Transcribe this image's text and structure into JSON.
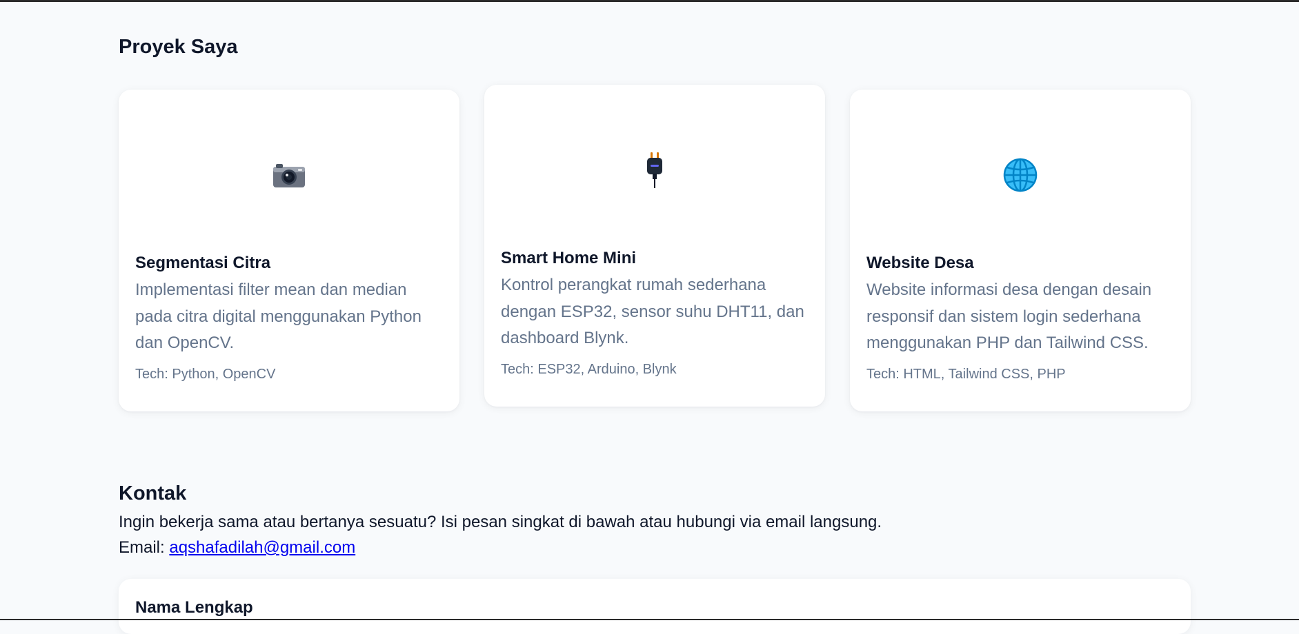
{
  "projects": {
    "title": "Proyek Saya",
    "items": [
      {
        "icon": "camera-icon",
        "title": "Segmentasi Citra",
        "description": "Implementasi filter mean dan median pada citra digital menggunakan Python dan OpenCV.",
        "tech": "Tech: Python, OpenCV"
      },
      {
        "icon": "electric-plug-icon",
        "title": "Smart Home Mini",
        "description": "Kontrol perangkat rumah sederhana dengan ESP32, sensor suhu DHT11, dan dashboard Blynk.",
        "tech": "Tech: ESP32, Arduino, Blynk"
      },
      {
        "icon": "globe-icon",
        "title": "Website Desa",
        "description": "Website informasi desa dengan desain responsif dan sistem login sederhana menggunakan PHP dan Tailwind CSS.",
        "tech": "Tech: HTML, Tailwind CSS, PHP"
      }
    ]
  },
  "contact": {
    "title": "Kontak",
    "text": "Ingin bekerja sama atau bertanya sesuatu? Isi pesan singkat di bawah atau hubungi via email langsung.",
    "email_label": "Email:",
    "email": "aqshafadilah@gmail.com"
  },
  "form": {
    "name_label": "Nama Lengkap"
  }
}
